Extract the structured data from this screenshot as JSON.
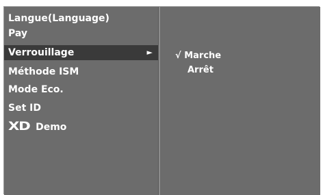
{
  "menu": {
    "items": [
      {
        "label": "Langue(Language)"
      },
      {
        "label": "Pay"
      },
      {
        "label": "Verrouillage",
        "arrow": "►"
      },
      {
        "label": "Méthode ISM"
      },
      {
        "label": "Mode Eco."
      },
      {
        "label": "Set ID"
      },
      {
        "logo": "XD",
        "label": "Demo"
      }
    ]
  },
  "submenu": {
    "check_mark": "√",
    "options": [
      {
        "label": "Marche"
      },
      {
        "label": "Arrêt"
      }
    ]
  },
  "colors": {
    "panel": "#6c6c6c",
    "selected_row": "#3a3a3a",
    "text": "#ffffff"
  }
}
